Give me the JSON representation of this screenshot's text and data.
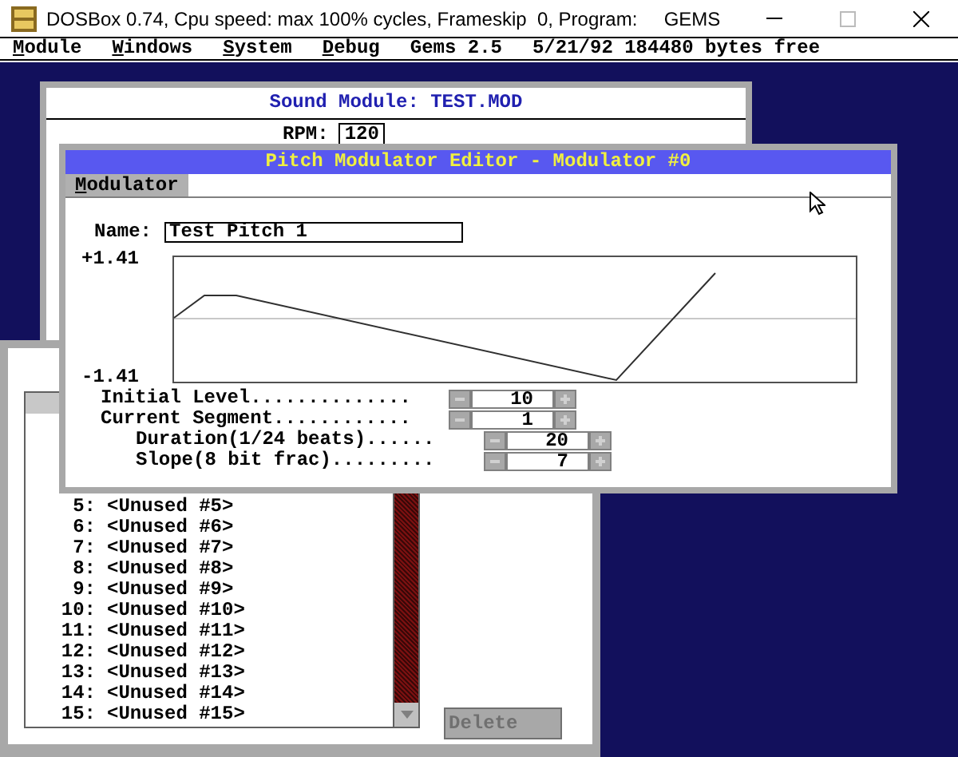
{
  "window": {
    "title": "DOSBox 0.74, Cpu speed: max 100% cycles, Frameskip  0, Program:     GEMS"
  },
  "menu": [
    {
      "label": "Module",
      "hotkey": true
    },
    {
      "label": "Windows",
      "hotkey": true
    },
    {
      "label": "System",
      "hotkey": true
    },
    {
      "label": "Debug",
      "hotkey": true
    },
    {
      "label": "Gems 2.5",
      "hotkey": false
    },
    {
      "label": "5/21/92 184480 bytes free",
      "hotkey": false
    }
  ],
  "sound_module": {
    "title": "Sound Module: TEST.MOD",
    "rpm_label": "RPM:",
    "rpm_value": "120"
  },
  "list_window": {
    "items": [
      {
        "number": "5:",
        "name": "<Unused #5>"
      },
      {
        "number": "6:",
        "name": "<Unused #6>"
      },
      {
        "number": "7:",
        "name": "<Unused #7>"
      },
      {
        "number": "8:",
        "name": "<Unused #8>"
      },
      {
        "number": "9:",
        "name": "<Unused #9>"
      },
      {
        "number": "10:",
        "name": "<Unused #10>"
      },
      {
        "number": "11:",
        "name": "<Unused #11>"
      },
      {
        "number": "12:",
        "name": "<Unused #12>"
      },
      {
        "number": "13:",
        "name": "<Unused #13>"
      },
      {
        "number": "14:",
        "name": "<Unused #14>"
      },
      {
        "number": "15:",
        "name": "<Unused #15>"
      }
    ],
    "delete_button": {
      "label": "Delete",
      "disabled": true
    }
  },
  "editor": {
    "title": "Pitch Modulator Editor - Modulator #0",
    "menu": [
      {
        "label": "Modulator",
        "hotkey": true,
        "selected": true
      }
    ],
    "name_label": "Name:",
    "name_value": "Test Pitch 1",
    "y_max": "+1.41",
    "y_min": "-1.41",
    "params": [
      {
        "label": "Initial Level..............",
        "value": "10",
        "indented": false
      },
      {
        "label": "Current Segment............",
        "value": "1",
        "indented": false
      },
      {
        "label": "Duration(1/24 beats)......",
        "value": "20",
        "indented": true
      },
      {
        "label": "Slope(8 bit frac).........",
        "value": "7",
        "indented": true
      }
    ]
  }
}
